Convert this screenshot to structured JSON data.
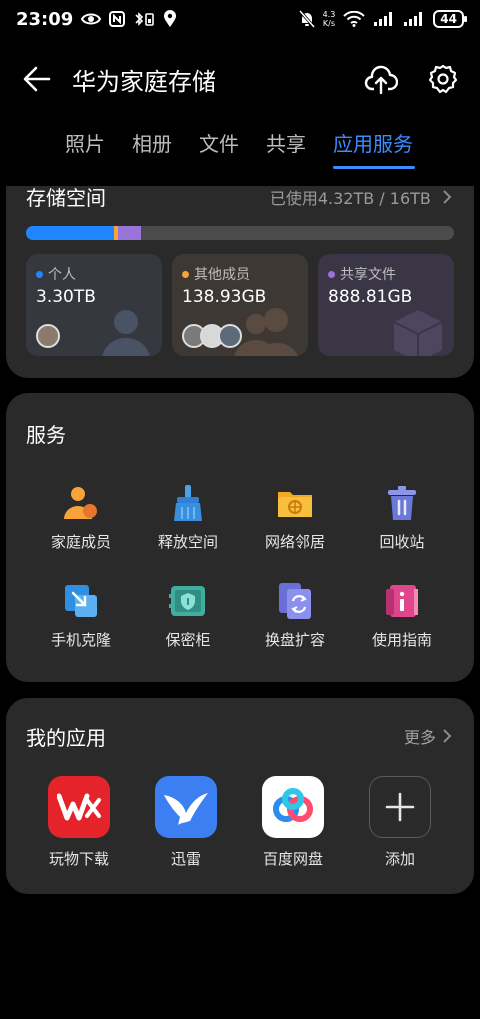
{
  "status_bar": {
    "time": "23:09",
    "net_speed_value": "4.3",
    "net_speed_unit": "K/s",
    "battery": "44"
  },
  "header": {
    "title": "华为家庭存储"
  },
  "tabs": [
    {
      "label": "照片"
    },
    {
      "label": "相册"
    },
    {
      "label": "文件"
    },
    {
      "label": "共享"
    },
    {
      "label": "应用服务",
      "active": true
    }
  ],
  "storage": {
    "title": "存储空间",
    "used_text": "已使用4.32TB / 16TB",
    "bar": {
      "personal": 0.206,
      "others": 0.008,
      "shared": 0.055
    },
    "colors": {
      "personal": "#1f86ff",
      "others": "#f7a33a",
      "shared": "#9a73d9",
      "empty": "#4b4b4b"
    },
    "categories": [
      {
        "label": "个人",
        "value": "3.30TB",
        "dot_color": "#1f86ff"
      },
      {
        "label": "其他成员",
        "value": "138.93GB",
        "dot_color": "#f7a33a"
      },
      {
        "label": "共享文件",
        "value": "888.81GB",
        "dot_color": "#9a73d9"
      }
    ]
  },
  "services": {
    "title": "服务",
    "items": [
      {
        "label": "家庭成员",
        "icon": "family-members-icon"
      },
      {
        "label": "释放空间",
        "icon": "broom-icon"
      },
      {
        "label": "网络邻居",
        "icon": "network-folder-icon"
      },
      {
        "label": "回收站",
        "icon": "trash-icon"
      },
      {
        "label": "手机克隆",
        "icon": "phone-clone-icon"
      },
      {
        "label": "保密柜",
        "icon": "safe-icon"
      },
      {
        "label": "换盘扩容",
        "icon": "disk-swap-icon"
      },
      {
        "label": "使用指南",
        "icon": "guide-icon"
      }
    ]
  },
  "my_apps": {
    "title": "我的应用",
    "more": "更多",
    "items": [
      {
        "label": "玩物下载",
        "icon": "wanwu-download-icon",
        "color": "#e5232b"
      },
      {
        "label": "迅雷",
        "icon": "xunlei-icon",
        "color": "#3b7ff3"
      },
      {
        "label": "百度网盘",
        "icon": "baidu-netdisk-icon",
        "color": "#ffffff"
      },
      {
        "label": "添加",
        "icon": "add-icon",
        "color": "#2a2a2a"
      }
    ]
  }
}
